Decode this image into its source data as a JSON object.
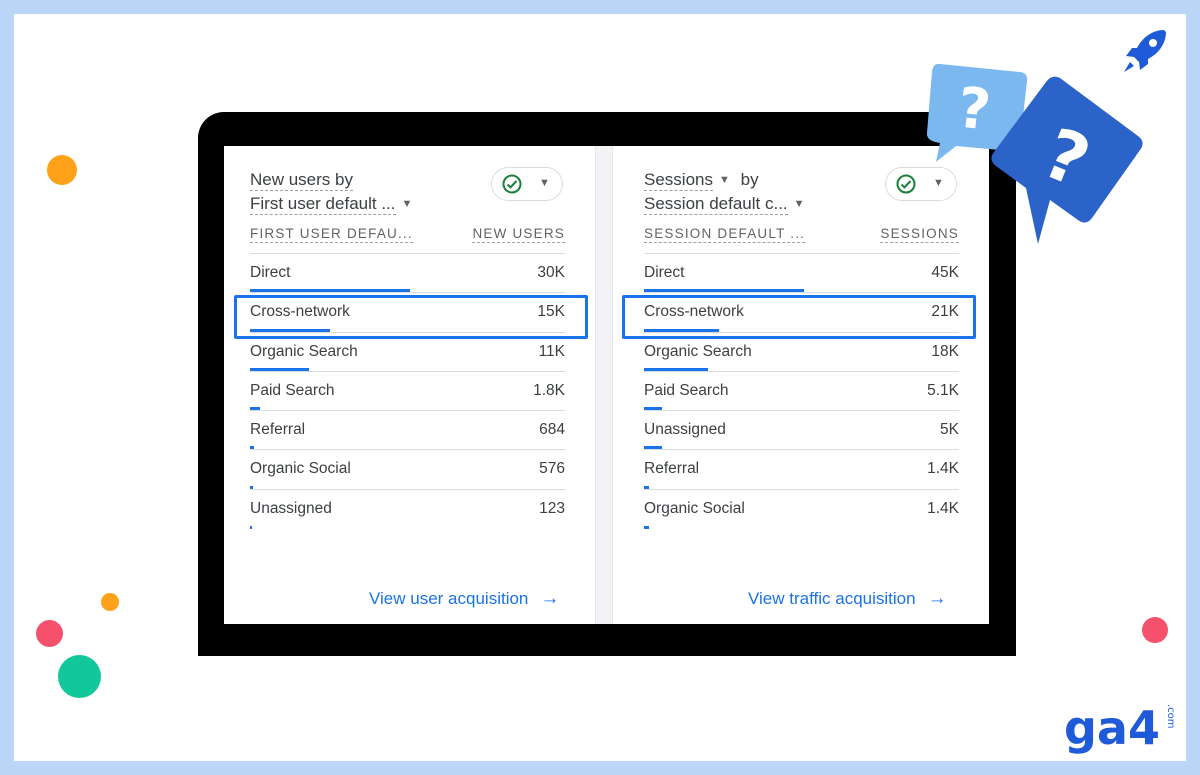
{
  "colors": {
    "accent": "#1a73e8",
    "dot_orange": "#ffa21a",
    "dot_pink": "#f5516c",
    "dot_teal": "#12c79a",
    "background": "#bcd6f7"
  },
  "left_card": {
    "title_line1": "New users by",
    "title_line2": "First user default ...",
    "col_dimension": "FIRST USER DEFAU...",
    "col_metric": "NEW USERS",
    "rows": [
      {
        "label": "Direct",
        "value": "30K",
        "share": 1.0
      },
      {
        "label": "Cross-network",
        "value": "15K",
        "share": 0.5
      },
      {
        "label": "Organic Search",
        "value": "11K",
        "share": 0.37
      },
      {
        "label": "Paid Search",
        "value": "1.8K",
        "share": 0.06
      },
      {
        "label": "Referral",
        "value": "684",
        "share": 0.023
      },
      {
        "label": "Organic Social",
        "value": "576",
        "share": 0.019
      },
      {
        "label": "Unassigned",
        "value": "123",
        "share": 0.004
      }
    ],
    "footer_link": "View user acquisition",
    "highlighted_row": "Cross-network"
  },
  "right_card": {
    "title_metric": "Sessions",
    "title_by": "by",
    "title_line2": "Session default c...",
    "col_dimension": "SESSION DEFAULT ...",
    "col_metric": "SESSIONS",
    "rows": [
      {
        "label": "Direct",
        "value": "45K",
        "share": 1.0
      },
      {
        "label": "Cross-network",
        "value": "21K",
        "share": 0.47
      },
      {
        "label": "Organic Search",
        "value": "18K",
        "share": 0.4
      },
      {
        "label": "Paid Search",
        "value": "5.1K",
        "share": 0.113
      },
      {
        "label": "Unassigned",
        "value": "5K",
        "share": 0.111
      },
      {
        "label": "Referral",
        "value": "1.4K",
        "share": 0.031
      },
      {
        "label": "Organic Social",
        "value": "1.4K",
        "share": 0.031
      }
    ],
    "footer_link": "View traffic acquisition",
    "highlighted_row": "Cross-network"
  },
  "icons": {
    "check": "check-circle-icon",
    "caret": "caret-down-icon",
    "arrow": "arrow-right-icon",
    "bubbles": "question-bubble-icon",
    "rocket": "rocket-icon"
  },
  "logo": {
    "text": "ga4",
    "suffix": ".com"
  }
}
